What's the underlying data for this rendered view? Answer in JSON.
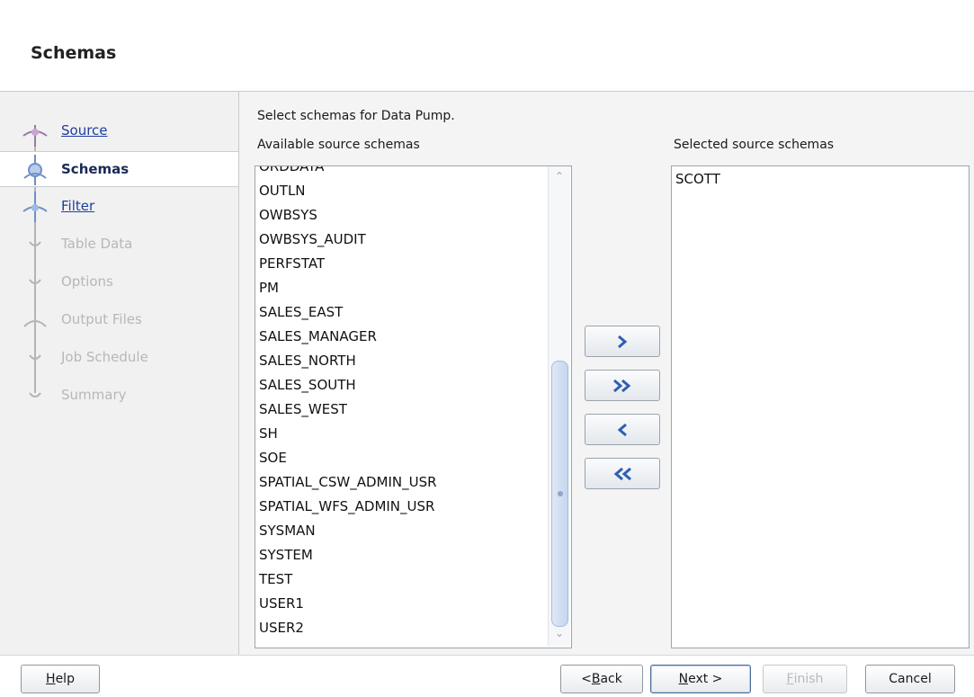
{
  "header": {
    "title": "Schemas"
  },
  "steps": [
    {
      "label": "Source",
      "state": "link"
    },
    {
      "label": "Schemas",
      "state": "current"
    },
    {
      "label": "Filter",
      "state": "link"
    },
    {
      "label": "Table Data",
      "state": "disabled"
    },
    {
      "label": "Options",
      "state": "disabled"
    },
    {
      "label": "Output Files",
      "state": "disabled"
    },
    {
      "label": "Job Schedule",
      "state": "disabled"
    },
    {
      "label": "Summary",
      "state": "disabled"
    }
  ],
  "content": {
    "instruction": "Select schemas for Data Pump.",
    "available_label": "Available source schemas",
    "selected_label": "Selected source schemas",
    "available_items": [
      "ORDDATA",
      "OUTLN",
      "OWBSYS",
      "OWBSYS_AUDIT",
      "PERFSTAT",
      "PM",
      "SALES_EAST",
      "SALES_MANAGER",
      "SALES_NORTH",
      "SALES_SOUTH",
      "SALES_WEST",
      "SH",
      "SOE",
      "SPATIAL_CSW_ADMIN_USR",
      "SPATIAL_WFS_ADMIN_USR",
      "SYSMAN",
      "SYSTEM",
      "TEST",
      "USER1",
      "USER2"
    ],
    "selected_items": [
      "SCOTT"
    ]
  },
  "shuttle_buttons": [
    {
      "name": "move-selected-right-button",
      "icon": "single-chevron-right-icon"
    },
    {
      "name": "move-all-right-button",
      "icon": "double-chevron-right-icon"
    },
    {
      "name": "move-selected-left-button",
      "icon": "single-chevron-left-icon"
    },
    {
      "name": "move-all-left-button",
      "icon": "double-chevron-left-icon"
    }
  ],
  "footer": {
    "help": {
      "pre": "",
      "mnemonic": "H",
      "post": "elp"
    },
    "back": {
      "pre": "< ",
      "mnemonic": "B",
      "post": "ack"
    },
    "next": {
      "pre": "",
      "mnemonic": "N",
      "post": "ext >"
    },
    "finish": {
      "pre": "",
      "mnemonic": "F",
      "post": "inish"
    },
    "cancel": {
      "pre": "Cancel",
      "mnemonic": "",
      "post": ""
    }
  },
  "colors": {
    "link": "#1d3f9e",
    "shuttle_arrow": "#2f5fb0",
    "step_icon_active": "#6f8fc7",
    "step_icon_source": "#9b7aa6"
  }
}
